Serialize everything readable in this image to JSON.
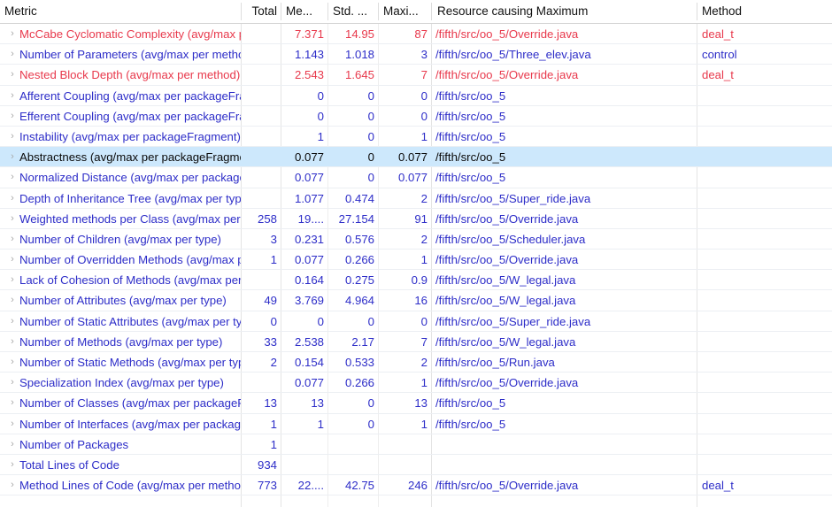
{
  "view": {
    "name": "Metrics View",
    "selected_row_index": 6
  },
  "colors": {
    "blue_text": "#2d2dc8",
    "red_text": "#e8394c",
    "selection_bg": "#cde8fc",
    "grid_line": "#e4e4e4",
    "header_text": "#111111"
  },
  "icons": {
    "expand_chevron": "›"
  },
  "columns": [
    {
      "key": "metric",
      "label": "Metric"
    },
    {
      "key": "total",
      "label": "Total"
    },
    {
      "key": "mean",
      "label": "Me..."
    },
    {
      "key": "std",
      "label": "Std. ..."
    },
    {
      "key": "max",
      "label": "Maxi..."
    },
    {
      "key": "resource",
      "label": "Resource causing Maximum"
    },
    {
      "key": "method",
      "label": "Method"
    }
  ],
  "rows": [
    {
      "metric": "McCabe Cyclomatic Complexity (avg/max per method)",
      "total": "",
      "mean": "7.371",
      "std": "14.95",
      "max": "87",
      "resource": "/fifth/src/oo_5/Override.java",
      "method": "deal_t",
      "severity": "red",
      "expandable": true,
      "selected": false
    },
    {
      "metric": "Number of Parameters (avg/max per method)",
      "total": "",
      "mean": "1.143",
      "std": "1.018",
      "max": "3",
      "resource": "/fifth/src/oo_5/Three_elev.java",
      "method": "control",
      "severity": "blue",
      "expandable": true,
      "selected": false
    },
    {
      "metric": "Nested Block Depth (avg/max per method)",
      "total": "",
      "mean": "2.543",
      "std": "1.645",
      "max": "7",
      "resource": "/fifth/src/oo_5/Override.java",
      "method": "deal_t",
      "severity": "red",
      "expandable": true,
      "selected": false
    },
    {
      "metric": "Afferent Coupling (avg/max per packageFragment)",
      "total": "",
      "mean": "0",
      "std": "0",
      "max": "0",
      "resource": "/fifth/src/oo_5",
      "method": "",
      "severity": "blue",
      "expandable": true,
      "selected": false
    },
    {
      "metric": "Efferent Coupling (avg/max per packageFragment)",
      "total": "",
      "mean": "0",
      "std": "0",
      "max": "0",
      "resource": "/fifth/src/oo_5",
      "method": "",
      "severity": "blue",
      "expandable": true,
      "selected": false
    },
    {
      "metric": "Instability (avg/max per packageFragment)",
      "total": "",
      "mean": "1",
      "std": "0",
      "max": "1",
      "resource": "/fifth/src/oo_5",
      "method": "",
      "severity": "blue",
      "expandable": true,
      "selected": false
    },
    {
      "metric": "Abstractness (avg/max per packageFragment)",
      "total": "",
      "mean": "0.077",
      "std": "0",
      "max": "0.077",
      "resource": "/fifth/src/oo_5",
      "method": "",
      "severity": "blue",
      "expandable": true,
      "selected": true
    },
    {
      "metric": "Normalized Distance (avg/max per packageFragment)",
      "total": "",
      "mean": "0.077",
      "std": "0",
      "max": "0.077",
      "resource": "/fifth/src/oo_5",
      "method": "",
      "severity": "blue",
      "expandable": true,
      "selected": false
    },
    {
      "metric": "Depth of Inheritance Tree (avg/max per type)",
      "total": "",
      "mean": "1.077",
      "std": "0.474",
      "max": "2",
      "resource": "/fifth/src/oo_5/Super_ride.java",
      "method": "",
      "severity": "blue",
      "expandable": true,
      "selected": false
    },
    {
      "metric": "Weighted methods per Class (avg/max per type)",
      "total": "258",
      "mean": "19....",
      "std": "27.154",
      "max": "91",
      "resource": "/fifth/src/oo_5/Override.java",
      "method": "",
      "severity": "blue",
      "expandable": true,
      "selected": false
    },
    {
      "metric": "Number of Children (avg/max per type)",
      "total": "3",
      "mean": "0.231",
      "std": "0.576",
      "max": "2",
      "resource": "/fifth/src/oo_5/Scheduler.java",
      "method": "",
      "severity": "blue",
      "expandable": true,
      "selected": false
    },
    {
      "metric": "Number of Overridden Methods (avg/max per type)",
      "total": "1",
      "mean": "0.077",
      "std": "0.266",
      "max": "1",
      "resource": "/fifth/src/oo_5/Override.java",
      "method": "",
      "severity": "blue",
      "expandable": true,
      "selected": false
    },
    {
      "metric": "Lack of Cohesion of Methods (avg/max per type)",
      "total": "",
      "mean": "0.164",
      "std": "0.275",
      "max": "0.9",
      "resource": "/fifth/src/oo_5/W_legal.java",
      "method": "",
      "severity": "blue",
      "expandable": true,
      "selected": false
    },
    {
      "metric": "Number of Attributes (avg/max per type)",
      "total": "49",
      "mean": "3.769",
      "std": "4.964",
      "max": "16",
      "resource": "/fifth/src/oo_5/W_legal.java",
      "method": "",
      "severity": "blue",
      "expandable": true,
      "selected": false
    },
    {
      "metric": "Number of Static Attributes (avg/max per type)",
      "total": "0",
      "mean": "0",
      "std": "0",
      "max": "0",
      "resource": "/fifth/src/oo_5/Super_ride.java",
      "method": "",
      "severity": "blue",
      "expandable": true,
      "selected": false
    },
    {
      "metric": "Number of Methods (avg/max per type)",
      "total": "33",
      "mean": "2.538",
      "std": "2.17",
      "max": "7",
      "resource": "/fifth/src/oo_5/W_legal.java",
      "method": "",
      "severity": "blue",
      "expandable": true,
      "selected": false
    },
    {
      "metric": "Number of Static Methods (avg/max per type)",
      "total": "2",
      "mean": "0.154",
      "std": "0.533",
      "max": "2",
      "resource": "/fifth/src/oo_5/Run.java",
      "method": "",
      "severity": "blue",
      "expandable": true,
      "selected": false
    },
    {
      "metric": "Specialization Index (avg/max per type)",
      "total": "",
      "mean": "0.077",
      "std": "0.266",
      "max": "1",
      "resource": "/fifth/src/oo_5/Override.java",
      "method": "",
      "severity": "blue",
      "expandable": true,
      "selected": false
    },
    {
      "metric": "Number of Classes (avg/max per packageFragment)",
      "total": "13",
      "mean": "13",
      "std": "0",
      "max": "13",
      "resource": "/fifth/src/oo_5",
      "method": "",
      "severity": "blue",
      "expandable": true,
      "selected": false
    },
    {
      "metric": "Number of Interfaces (avg/max per packageFragment)",
      "total": "1",
      "mean": "1",
      "std": "0",
      "max": "1",
      "resource": "/fifth/src/oo_5",
      "method": "",
      "severity": "blue",
      "expandable": true,
      "selected": false
    },
    {
      "metric": "Number of Packages",
      "total": "1",
      "mean": "",
      "std": "",
      "max": "",
      "resource": "",
      "method": "",
      "severity": "blue",
      "expandable": true,
      "selected": false
    },
    {
      "metric": "Total Lines of Code",
      "total": "934",
      "mean": "",
      "std": "",
      "max": "",
      "resource": "",
      "method": "",
      "severity": "blue",
      "expandable": true,
      "selected": false
    },
    {
      "metric": "Method Lines of Code (avg/max per method)",
      "total": "773",
      "mean": "22....",
      "std": "42.75",
      "max": "246",
      "resource": "/fifth/src/oo_5/Override.java",
      "method": "deal_t",
      "severity": "blue",
      "expandable": true,
      "selected": false
    }
  ]
}
